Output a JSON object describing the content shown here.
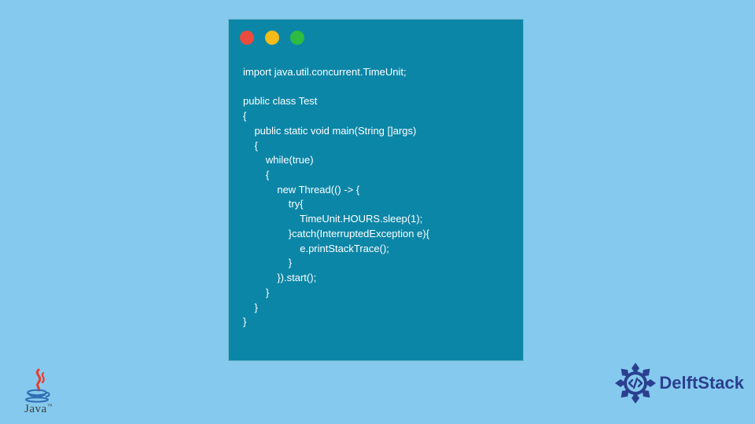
{
  "window": {
    "traffic": {
      "buttons": [
        "close",
        "minimize",
        "maximize"
      ]
    }
  },
  "code": {
    "text": "import java.util.concurrent.TimeUnit;\n\npublic class Test\n{\n    public static void main(String []args)\n    {\n        while(true)\n        {\n            new Thread(() -> {\n                try{\n                    TimeUnit.HOURS.sleep(1);\n                }catch(InterruptedException e){\n                    e.printStackTrace();\n                }\n            }).start();\n        }\n    }\n}"
  },
  "logos": {
    "java": {
      "label": "Java",
      "tm": "™"
    },
    "delftstack": {
      "label": "DelftStack"
    }
  },
  "colors": {
    "bg": "#85caee",
    "window": "#0c86a7",
    "ds_blue": "#2b3f8f"
  }
}
